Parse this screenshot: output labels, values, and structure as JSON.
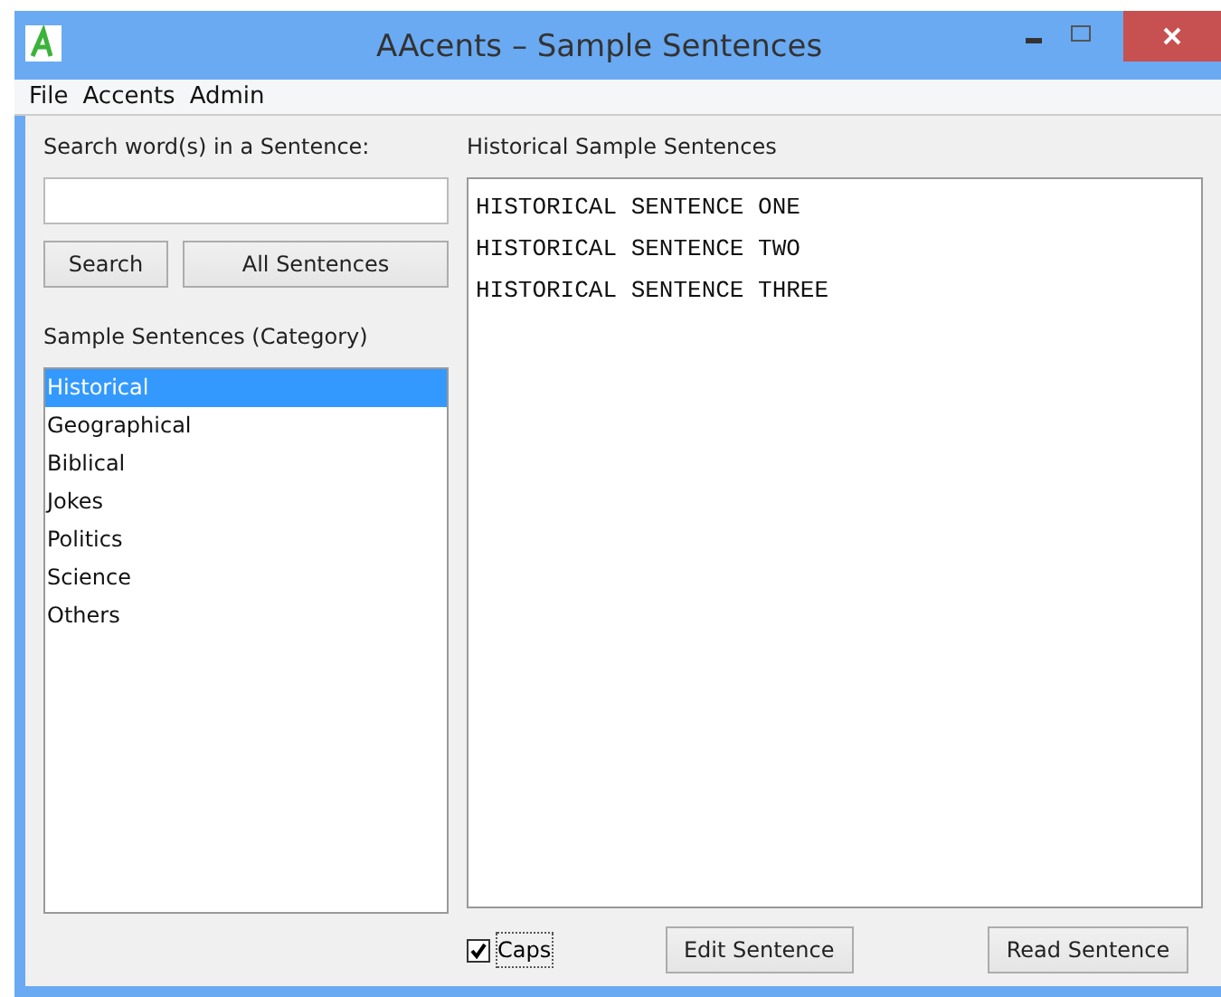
{
  "window": {
    "title": "AAcents – Sample Sentences"
  },
  "menu": [
    "File",
    "Accents",
    "Admin"
  ],
  "search": {
    "label": "Search word(s) in a Sentence:",
    "buttons": [
      "Search",
      "All Sentences"
    ]
  },
  "categories": {
    "label": "Sample Sentences (Category)",
    "items": [
      {
        "label": "Historical",
        "selected": true
      },
      {
        "label": "Geographical",
        "selected": false
      },
      {
        "label": "Biblical",
        "selected": false
      },
      {
        "label": "Jokes",
        "selected": false
      },
      {
        "label": "Politics",
        "selected": false
      },
      {
        "label": "Science",
        "selected": false
      },
      {
        "label": "Others",
        "selected": false
      }
    ]
  },
  "sentences": {
    "label": "Historical Sample Sentences",
    "lines": [
      "HISTORICAL SENTENCE ONE",
      "HISTORICAL SENTENCE TWO",
      "HISTORICAL SENTENCE THREE"
    ]
  },
  "caps": {
    "label": "Caps",
    "checked": true
  },
  "buttons": [
    "Edit Sentence",
    "Read Sentence"
  ]
}
